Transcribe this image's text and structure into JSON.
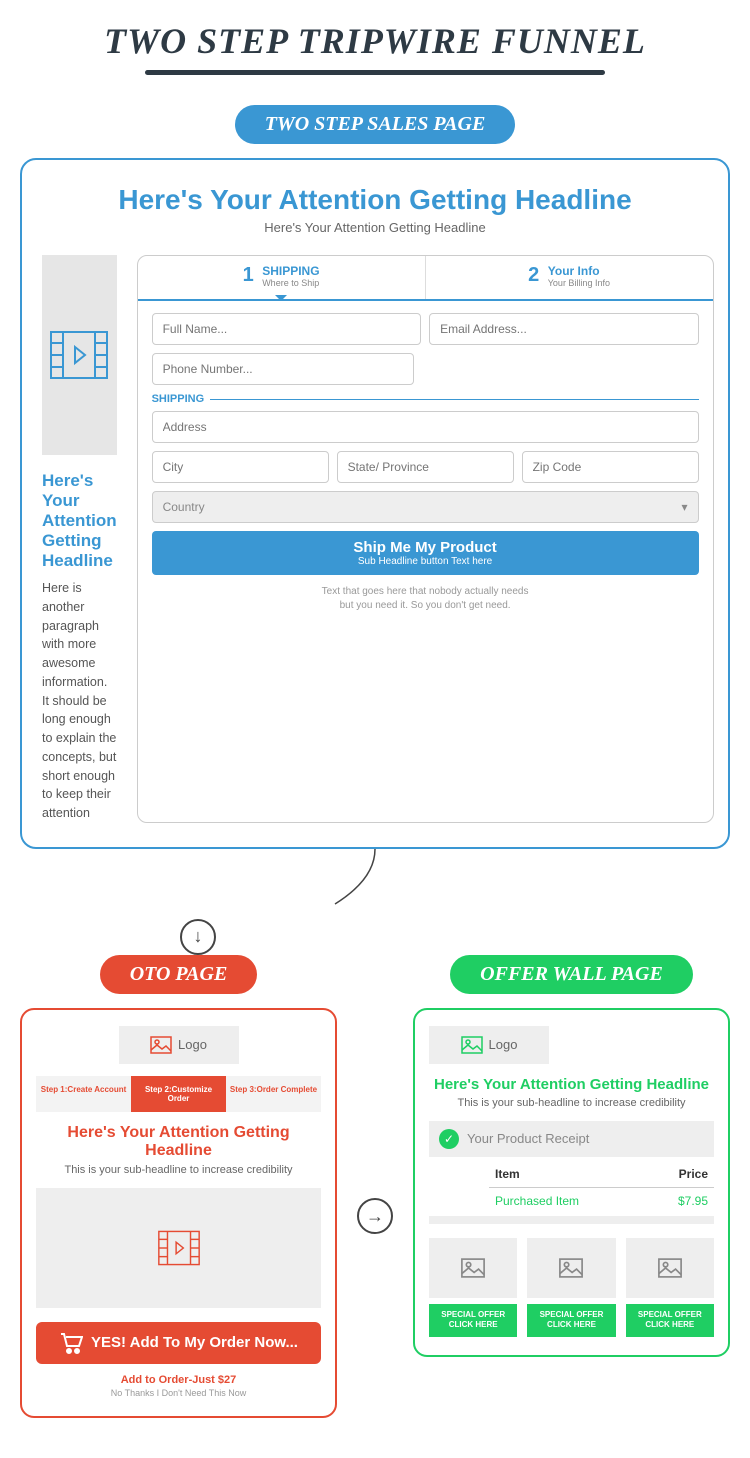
{
  "title": "TWO STEP TRIPWIRE FUNNEL",
  "pills": {
    "sales": "TWO STEP SALES PAGE",
    "oto": "OTO PAGE",
    "offerwall": "OFFER WALL PAGE"
  },
  "sales": {
    "headline": "Here's Your Attention Getting Headline",
    "subheadline": "Here's Your Attention Getting Headline",
    "leftHeadline": "Here's Your Attention Getting Headline",
    "paragraph": "Here is another paragraph with more awesome information. It should be long enough to explain the concepts, but short enough to keep their attention",
    "tabs": {
      "t1": {
        "num": "1",
        "title": "SHIPPING",
        "sub": "Where to Ship"
      },
      "t2": {
        "num": "2",
        "title": "Your Info",
        "sub": "Your Billing Info"
      }
    },
    "fields": {
      "fullname": "Full Name...",
      "email": "Email Address...",
      "phone": "Phone Number...",
      "shippingLabel": "SHIPPING",
      "address": "Address",
      "city": "City",
      "state": "State/ Province",
      "zip": "Zip Code",
      "country": "Country"
    },
    "button": {
      "title": "Ship Me My Product",
      "sub": "Sub Headline button Text here"
    },
    "disclaimer1": "Text that goes here that nobody actually needs",
    "disclaimer2": "but you need it. So you don't get need."
  },
  "oto": {
    "logo": "Logo",
    "steps": {
      "s1": "Step 1:Create Account",
      "s2": "Step 2:Customize Order",
      "s3": "Step 3:Order Complete"
    },
    "headline": "Here's Your Attention Getting Headline",
    "sub": "This is your sub-headline to increase credibility",
    "cta": "YES! Add To My Order Now...",
    "addOrder": "Add to Order-Just $27",
    "noThanks": "No Thanks I Don't Need This Now"
  },
  "offerwall": {
    "logo": "Logo",
    "headline": "Here's Your Attention Getting Headline",
    "sub": "This is your sub-headline to increase credibility",
    "receipt": "Your Product Receipt",
    "table": {
      "h1": "Item",
      "h2": "Price",
      "item": "Purchased Item",
      "price": "$7.95"
    },
    "offerBtn1": "SPECIAL OFFER",
    "offerBtn2": "CLICK HERE"
  }
}
